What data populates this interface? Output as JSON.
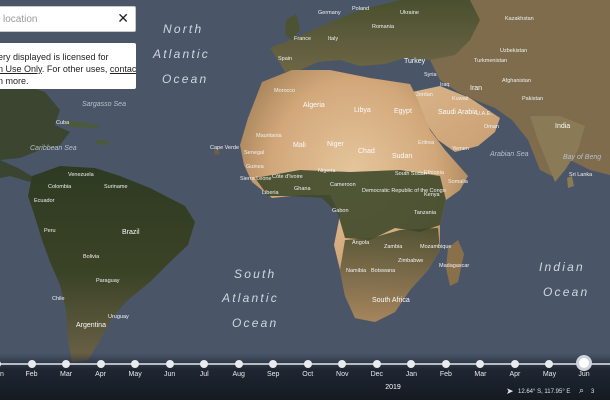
{
  "search": {
    "placeholder": "location",
    "close_label": "✕"
  },
  "notice": {
    "line1": "ery displayed is licensed for",
    "line2_link": "n Use Only",
    "line2_mid": ". For other uses, ",
    "line2_contact": "contact",
    "line3": "n more."
  },
  "map": {
    "oceans": [
      {
        "key": "north-atlantic",
        "lines": [
          "North",
          "Atlantic",
          "Ocean"
        ]
      },
      {
        "key": "south-atlantic",
        "lines": [
          "South",
          "Atlantic",
          "Ocean"
        ]
      },
      {
        "key": "indian",
        "lines": [
          "Indian",
          "Ocean"
        ]
      }
    ],
    "seas": {
      "sargasso": "Sargasso Sea",
      "caribbean": "Caribbean Sea",
      "arabian": "Arabian Sea",
      "bengal": "Bay of Beng"
    },
    "countries": {
      "algeria": "Algeria",
      "libya": "Libya",
      "egypt": "Egypt",
      "morocco": "Morocco",
      "mauritania": "Mauritania",
      "mali": "Mali",
      "niger": "Niger",
      "chad": "Chad",
      "sudan": "Sudan",
      "south_sudan": "South Sudan",
      "ethiopia": "Ethiopia",
      "kenya": "Kenya",
      "somalia": "Somalia",
      "tanzania": "Tanzania",
      "angola": "Angola",
      "zambia": "Zambia",
      "namibia": "Namibia",
      "botswana": "Botswana",
      "south_africa": "South Africa",
      "madagascar": "Madagascar",
      "drc": "Democratic Republic of the Congo",
      "nigeria": "Nigeria",
      "cameroon": "Cameroon",
      "ghana": "Ghana",
      "liberia": "Liberia",
      "sierra_leone": "Sierra Leone",
      "guinea": "Guinea",
      "senegal": "Senegal",
      "cape_verde": "Cape Verde",
      "cote_divoire": "Côte d'Ivoire",
      "gabon": "Gabon",
      "mozambique": "Mozambique",
      "zimbabwe": "Zimbabwe",
      "eritrea": "Eritrea",
      "yemen": "Yemen",
      "oman": "Oman",
      "saudi_arabia": "Saudi Arabia",
      "iraq": "Iraq",
      "iran": "Iran",
      "syria": "Syria",
      "jordan": "Jordan",
      "kuwait": "Kuwait",
      "uae": "U.A.E.",
      "turkey": "Turkey",
      "afghanistan": "Afghanistan",
      "pakistan": "Pakistan",
      "india": "India",
      "sri_lanka": "Sri Lanka",
      "kazakhstan": "Kazakhstan",
      "uzbekistan": "Uzbekistan",
      "turkmenistan": "Turkmenistan",
      "ukraine": "Ukraine",
      "romania": "Romania",
      "poland": "Poland",
      "germany": "Germany",
      "france": "France",
      "spain": "Spain",
      "italy": "Italy",
      "brazil": "Brazil",
      "peru": "Peru",
      "bolivia": "Bolivia",
      "argentina": "Argentina",
      "colombia": "Colombia",
      "venezuela": "Venezuela",
      "ecuador": "Ecuador",
      "paraguay": "Paraguay",
      "uruguay": "Uruguay",
      "chile": "Chile",
      "suriname": "Suriname",
      "cuba": "Cuba"
    }
  },
  "timeline": {
    "months": [
      "n",
      "Feb",
      "Mar",
      "Apr",
      "May",
      "Jun",
      "Jul",
      "Aug",
      "Sep",
      "Oct",
      "Nov",
      "Dec",
      "Jan",
      "Feb",
      "Mar",
      "Apr",
      "May",
      "Jun"
    ],
    "year_label": "2019",
    "current_index": 17
  },
  "status": {
    "coords": "12.64° S, 117.95° E",
    "zoom": "3"
  },
  "colors": {
    "ocean": "#4a5668",
    "sahara": "#d8b48a",
    "forest": "#2f3a24",
    "timeline_bg": "#161c26"
  }
}
